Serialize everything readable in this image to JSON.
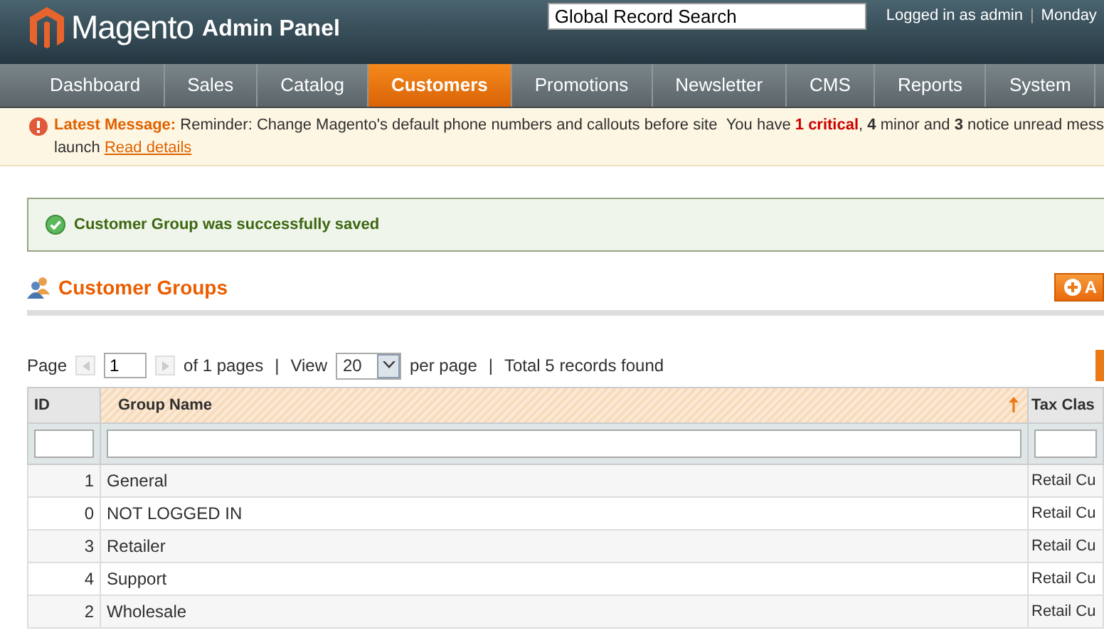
{
  "header": {
    "logo": "Magento",
    "logo_suffix": "Admin Panel",
    "search": {
      "value": "Global Record Search"
    },
    "user": "Logged in as admin",
    "separator": "|",
    "date": "Monday"
  },
  "nav": [
    {
      "label": "Dashboard",
      "selected": false
    },
    {
      "label": "Sales",
      "selected": false
    },
    {
      "label": "Catalog",
      "selected": false
    },
    {
      "label": "Customers",
      "selected": true
    },
    {
      "label": "Promotions",
      "selected": false
    },
    {
      "label": "Newsletter",
      "selected": false
    },
    {
      "label": "CMS",
      "selected": false
    },
    {
      "label": "Reports",
      "selected": false
    },
    {
      "label": "System",
      "selected": false
    }
  ],
  "notice": {
    "label": "Latest Message:",
    "text": "Reminder: Change Magento's default phone numbers and callouts before site launch",
    "link": "Read details",
    "summary": "You have **1 critical**, **4** minor and **3** notice unread mess"
  },
  "success": "Customer Group was successfully saved",
  "page_title": "Customer Groups",
  "add_button": "A",
  "pager": {
    "page_label": "Page",
    "page": "1",
    "of_pages": "of 1 pages",
    "separators": [
      "|",
      "|"
    ],
    "view_label": "View",
    "per_page": "20",
    "per_page_label": "per page",
    "total": "Total 5 records found"
  },
  "table": {
    "columns": [
      {
        "label": "ID",
        "sorted": false
      },
      {
        "label": "Group Name",
        "sorted": true
      },
      {
        "label": "Tax Clas",
        "sorted": false
      }
    ],
    "rows": [
      [
        "1",
        "General",
        "Retail Cu"
      ],
      [
        "0",
        "NOT LOGGED IN",
        "Retail Cu"
      ],
      [
        "3",
        "Retailer",
        "Retail Cu"
      ],
      [
        "4",
        "Support",
        "Retail Cu"
      ],
      [
        "2",
        "Wholesale",
        "Retail Cu"
      ]
    ]
  }
}
